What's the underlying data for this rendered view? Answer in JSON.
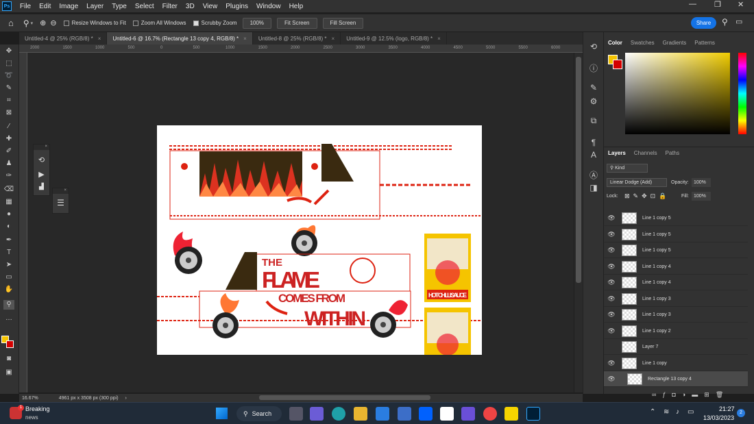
{
  "app": {
    "logo": "Ps"
  },
  "menu": [
    "File",
    "Edit",
    "Image",
    "Layer",
    "Type",
    "Select",
    "Filter",
    "3D",
    "View",
    "Plugins",
    "Window",
    "Help"
  ],
  "options": {
    "resize_label": "Resize Windows to Fit",
    "zoom_all_label": "Zoom All Windows",
    "scrubby_label": "Scrubby Zoom",
    "zoom_value": "100%",
    "fit_screen": "Fit Screen",
    "fill_screen": "Fill Screen",
    "share": "Share"
  },
  "tabs": [
    {
      "label": "Untitled-4 @ 25% (RGB/8) *"
    },
    {
      "label": "Untitled-6 @ 16.7% (Rectangle 13 copy 4, RGB/8) *"
    },
    {
      "label": "Untitled-8 @ 25% (RGB/8) *"
    },
    {
      "label": "Untitled-9 @ 12.5% (logo, RGB/8) *"
    }
  ],
  "ruler": [
    "2000",
    "1500",
    "1000",
    "500",
    "0",
    "500",
    "1000",
    "1500",
    "2000",
    "2500",
    "3000",
    "3500",
    "4000",
    "4500",
    "5000",
    "5500",
    "6000"
  ],
  "status": {
    "zoom": "16.67%",
    "doc_size": "4961 px x 3508 px (300 ppi)"
  },
  "artwork": {
    "line1": "THE",
    "line2": "FLAME",
    "line3": "COMES FROM",
    "line4": "WITHIN",
    "can_label": "HOT CHILLI SAUCE"
  },
  "color_panel": {
    "tabs": [
      "Color",
      "Swatches",
      "Gradients",
      "Patterns"
    ],
    "foreground": "#f5c400",
    "background": "#d40000"
  },
  "layers_panel": {
    "tabs": [
      "Layers",
      "Channels",
      "Paths"
    ],
    "kind": "Kind",
    "blend_mode": "Linear Dodge (Add)",
    "opacity_label": "Opacity:",
    "opacity": "100%",
    "lock_label": "Lock:",
    "fill_label": "Fill:",
    "fill": "100%",
    "layers": [
      {
        "name": "Line 1 copy 5",
        "visible": true
      },
      {
        "name": "Line 1 copy 5",
        "visible": true
      },
      {
        "name": "Line 1 copy 5",
        "visible": true
      },
      {
        "name": "Line 1 copy 4",
        "visible": true
      },
      {
        "name": "Line 1 copy 4",
        "visible": true
      },
      {
        "name": "Line 1 copy 3",
        "visible": true
      },
      {
        "name": "Line 1 copy 3",
        "visible": true
      },
      {
        "name": "Line 1 copy 2",
        "visible": true
      },
      {
        "name": "Layer 7",
        "visible": false
      },
      {
        "name": "Line 1 copy",
        "visible": true
      },
      {
        "name": "Rectangle 13 copy 4",
        "visible": true,
        "selected": true
      }
    ]
  },
  "taskbar": {
    "news_title": "Breaking",
    "news_sub": "news",
    "search": "Search",
    "time": "21:27",
    "date": "13/03/2023",
    "badge": "1",
    "notif": "2"
  }
}
